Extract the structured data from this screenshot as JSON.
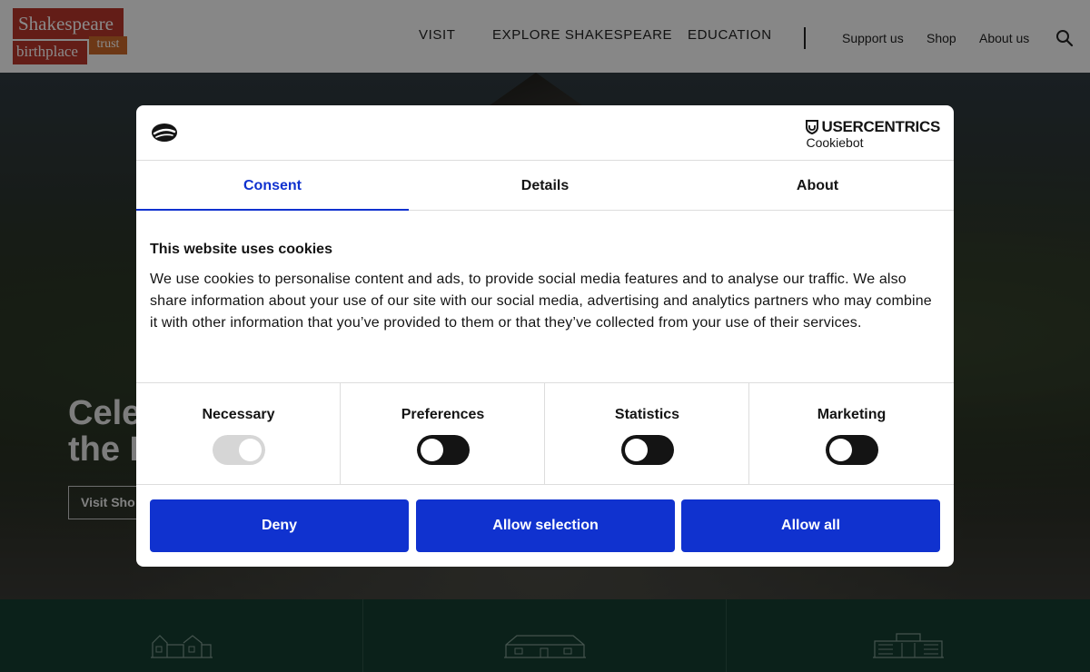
{
  "header": {
    "logo": {
      "line1": "Shakespeare",
      "line2": "birthplace",
      "line3": "trust"
    },
    "nav_main": [
      "VISIT",
      "EXPLORE SHAKESPEARE",
      "EDUCATION"
    ],
    "nav_secondary": [
      "Support us",
      "Shop",
      "About us"
    ]
  },
  "hero": {
    "heading_line1": "Cele",
    "heading_line2": "the I",
    "button_label": "Visit Sho"
  },
  "cookie_dialog": {
    "brand": {
      "name": "USERCENTRICS",
      "product": "Cookiebot"
    },
    "tabs": [
      {
        "label": "Consent",
        "active": true
      },
      {
        "label": "Details",
        "active": false
      },
      {
        "label": "About",
        "active": false
      }
    ],
    "title": "This website uses cookies",
    "body": "We use cookies to personalise content and ads, to provide social media features and to analyse our traffic. We also share information about your use of our site with our social media, advertising and analytics partners who may combine it with other information that you’ve provided to them or that they’ve collected from your use of their services.",
    "categories": [
      {
        "label": "Necessary",
        "enabled": true,
        "locked": true
      },
      {
        "label": "Preferences",
        "enabled": false,
        "locked": false
      },
      {
        "label": "Statistics",
        "enabled": false,
        "locked": false
      },
      {
        "label": "Marketing",
        "enabled": false,
        "locked": false
      }
    ],
    "buttons": {
      "deny": "Deny",
      "allow_selection": "Allow selection",
      "allow_all": "Allow all"
    }
  },
  "colors": {
    "accent_blue": "#1032cf",
    "logo_red": "#b7362c",
    "logo_orange": "#c9682a",
    "band_green": "#163d31",
    "toggle_off": "#141414",
    "toggle_disabled": "#d6d6d6"
  }
}
